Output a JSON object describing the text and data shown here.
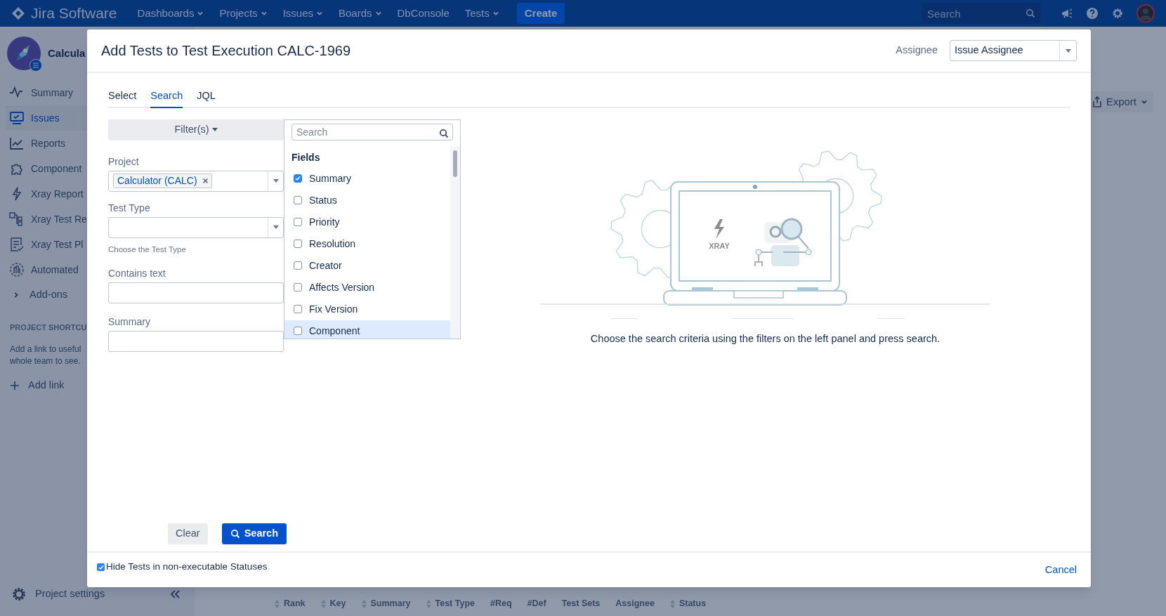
{
  "top_nav": {
    "logo": "Jira Software",
    "menus": [
      {
        "label": "Dashboards",
        "dropdown": true
      },
      {
        "label": "Projects",
        "dropdown": true
      },
      {
        "label": "Issues",
        "dropdown": true
      },
      {
        "label": "Boards",
        "dropdown": true
      },
      {
        "label": "DbConsole",
        "dropdown": false
      },
      {
        "label": "Tests",
        "dropdown": true
      }
    ],
    "create_button": "Create",
    "search": {
      "placeholder": "Search"
    }
  },
  "sidebar": {
    "project_name": "Calcula",
    "items": [
      {
        "label": "Summary",
        "selected": false
      },
      {
        "label": "Issues",
        "selected": true
      },
      {
        "label": "Reports",
        "selected": false
      },
      {
        "label": "Component",
        "selected": false
      },
      {
        "label": "Xray Report",
        "selected": false
      },
      {
        "label": "Xray Test Re",
        "selected": false
      },
      {
        "label": "Xray Test Pl",
        "selected": false
      },
      {
        "label": "Automated",
        "selected": false
      }
    ],
    "add_ons": "Add-ons",
    "shortcuts_heading": "PROJECT SHORTCU",
    "shortcuts_text": [
      "Add a link to useful",
      "whole team to see."
    ],
    "add_link": "Add link",
    "settings": "Project settings"
  },
  "page": {
    "export_button": "Export",
    "table_columns": [
      {
        "label": "Rank",
        "sortable": true
      },
      {
        "label": "Key",
        "sortable": true
      },
      {
        "label": "Summary",
        "sortable": true
      },
      {
        "label": "Test Type",
        "sortable": true
      },
      {
        "label": "#Req",
        "sortable": false
      },
      {
        "label": "#Def",
        "sortable": false
      },
      {
        "label": "Test Sets",
        "sortable": false
      },
      {
        "label": "Assignee",
        "sortable": false
      },
      {
        "label": "Status",
        "sortable": true
      }
    ]
  },
  "dialog": {
    "title": "Add Tests to Test Execution CALC-1969",
    "assignee_label": "Assignee",
    "assignee_value": "Issue Assignee",
    "tabs": [
      {
        "label": "Select",
        "selected": false
      },
      {
        "label": "Search",
        "selected": true
      },
      {
        "label": "JQL",
        "selected": false
      }
    ],
    "filters_button": "Filter(s)",
    "project": {
      "label": "Project",
      "tags": [
        "Calculator (CALC)"
      ]
    },
    "test_type": {
      "label": "Test Type",
      "hint": "Choose the Test Type"
    },
    "contains_text": {
      "label": "Contains text"
    },
    "summary": {
      "label": "Summary"
    },
    "field_picker": {
      "search_placeholder": "Search",
      "heading": "Fields",
      "fields": [
        {
          "label": "Summary",
          "checked": true,
          "highlighted": false
        },
        {
          "label": "Status",
          "checked": false,
          "highlighted": false
        },
        {
          "label": "Priority",
          "checked": false,
          "highlighted": false
        },
        {
          "label": "Resolution",
          "checked": false,
          "highlighted": false
        },
        {
          "label": "Creator",
          "checked": false,
          "highlighted": false
        },
        {
          "label": "Affects Version",
          "checked": false,
          "highlighted": false
        },
        {
          "label": "Fix Version",
          "checked": false,
          "highlighted": false
        },
        {
          "label": "Component",
          "checked": false,
          "highlighted": true
        }
      ]
    },
    "illustration_logo": "XRAY",
    "message": "Choose the search criteria using the filters on the left panel and press search.",
    "clear_button": "Clear",
    "search_button": "Search",
    "hide_tests": {
      "label": "Hide Tests in non-executable Statuses",
      "checked": true
    },
    "cancel": "Cancel"
  }
}
